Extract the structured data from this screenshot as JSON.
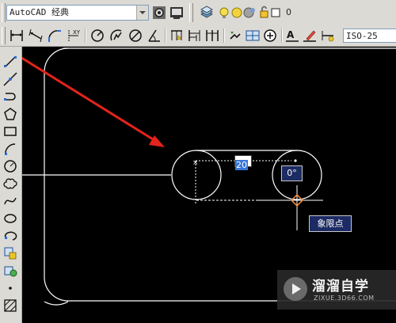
{
  "toolbar_top": {
    "workspace": "AutoCAD 经典",
    "layer_value": "0"
  },
  "toolbar_dim": {
    "dim_style": "ISO-25"
  },
  "canvas": {
    "dynamic_input_value": "20",
    "angle_value": "0°",
    "snap_tooltip": "象限点"
  },
  "watermark": {
    "title": "溜溜自学",
    "url": "ZIXUE.3D66.COM"
  },
  "colors": {
    "canvas_bg": "#000000",
    "arrow_red": "#e3241b",
    "snap_orange": "#ff8c3a",
    "tooltip_bg": "#1c2b63",
    "highlight_blue": "#3875d7"
  },
  "icons": {
    "left_toolbar": [
      "line-icon",
      "construction-line-icon",
      "polyline-icon",
      "polygon-icon",
      "rectangle-icon",
      "arc-icon",
      "circle-icon",
      "revision-cloud-icon",
      "spline-icon",
      "ellipse-icon",
      "ellipse-arc-icon",
      "insert-block-icon",
      "make-block-icon",
      "point-icon",
      "hatch-icon"
    ]
  }
}
